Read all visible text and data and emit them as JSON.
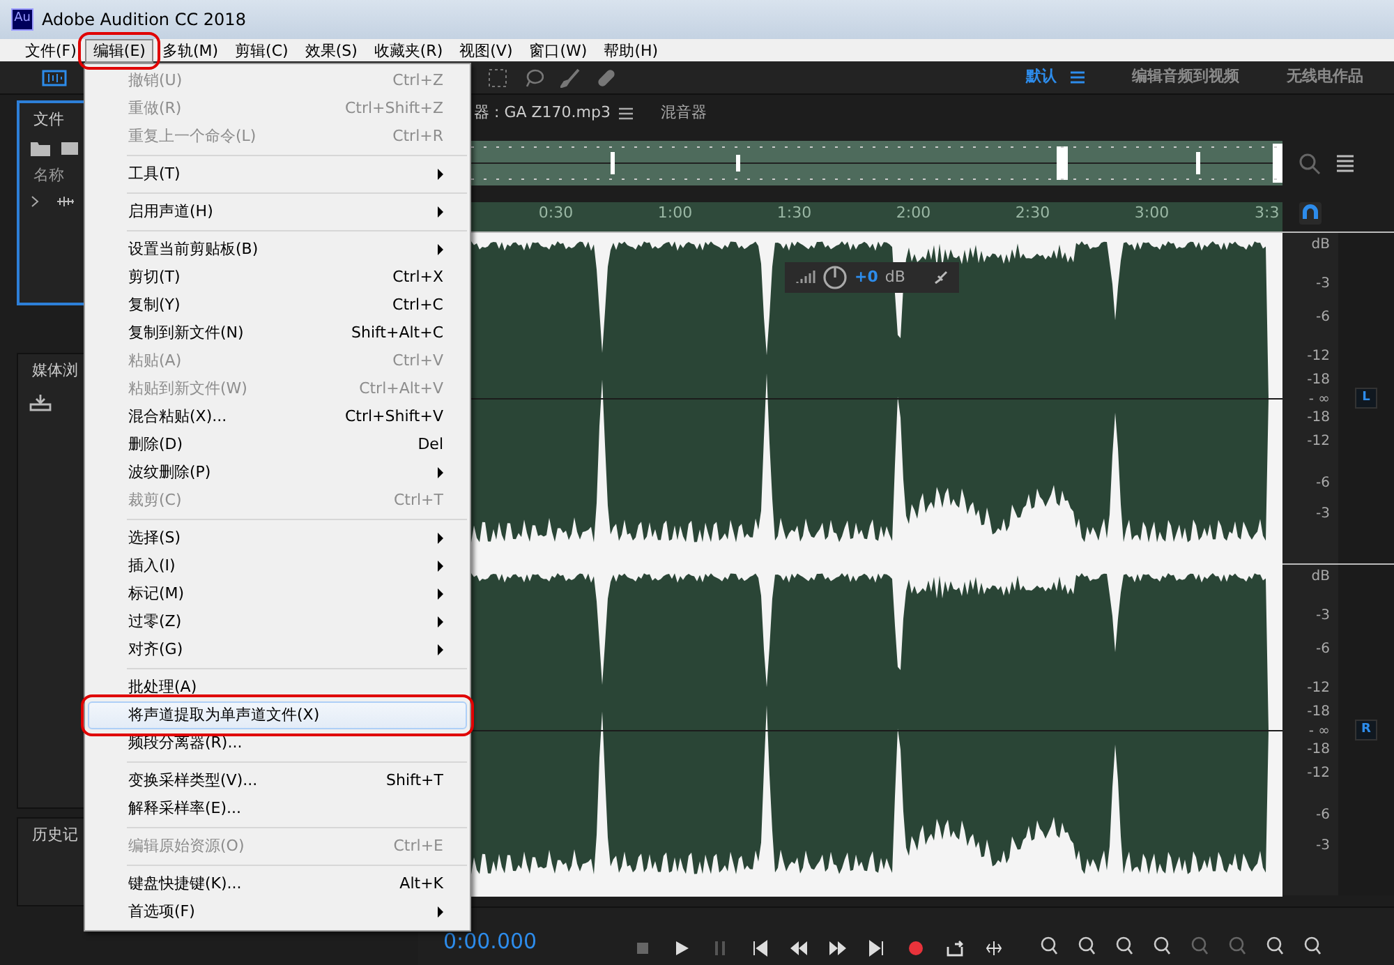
{
  "window": {
    "logo": "Au",
    "title": "Adobe Audition CC 2018"
  },
  "menubar": [
    {
      "label": "文件(F)",
      "selected": false,
      "circled": false
    },
    {
      "label": "编辑(E)",
      "selected": true,
      "circled": true
    },
    {
      "label": "多轨(M)",
      "selected": false,
      "circled": false
    },
    {
      "label": "剪辑(C)",
      "selected": false,
      "circled": false
    },
    {
      "label": "效果(S)",
      "selected": false,
      "circled": false
    },
    {
      "label": "收藏夹(R)",
      "selected": false,
      "circled": false
    },
    {
      "label": "视图(V)",
      "selected": false,
      "circled": false
    },
    {
      "label": "窗口(W)",
      "selected": false,
      "circled": false
    },
    {
      "label": "帮助(H)",
      "selected": false,
      "circled": false
    }
  ],
  "workspaces": [
    {
      "label": "默认",
      "selected": true
    },
    {
      "label": "编辑音频到视频",
      "selected": false
    },
    {
      "label": "无线电作品",
      "selected": false
    }
  ],
  "files_panel": {
    "tab": "文件",
    "column": "名称"
  },
  "media_panel": {
    "tab": "媒体浏"
  },
  "history_panel": {
    "tab": "历史记"
  },
  "editor": {
    "tabs": [
      {
        "label": "器 : GA  Z170.mp3",
        "selected": true
      },
      {
        "label": "混音器",
        "selected": false
      }
    ],
    "ruler": [
      "0:30",
      "1:00",
      "1:30",
      "2:00",
      "2:30",
      "3:00",
      "3:3"
    ],
    "hud": {
      "gain": "+0",
      "unit": "dB"
    },
    "channels": [
      {
        "label": "L",
        "scale": [
          "dB",
          "-3",
          "-6",
          "-12",
          "-18",
          "- ∞",
          "-18",
          "-12",
          "-6",
          "-3"
        ]
      },
      {
        "label": "R",
        "scale": [
          "dB",
          "-3",
          "-6",
          "-12",
          "-18",
          "- ∞",
          "-18",
          "-12",
          "-6",
          "-3"
        ]
      }
    ]
  },
  "transport": {
    "time": "0:00.000"
  },
  "edit_menu": [
    {
      "kind": "item",
      "label": "撤销(U)",
      "shortcut": "Ctrl+Z",
      "disabled": true,
      "submenu": false,
      "selected": false,
      "circled": false
    },
    {
      "kind": "item",
      "label": "重做(R)",
      "shortcut": "Ctrl+Shift+Z",
      "disabled": true,
      "submenu": false,
      "selected": false,
      "circled": false
    },
    {
      "kind": "item",
      "label": "重复上一个命令(L)",
      "shortcut": "Ctrl+R",
      "disabled": true,
      "submenu": false,
      "selected": false,
      "circled": false
    },
    {
      "kind": "separator"
    },
    {
      "kind": "item",
      "label": "工具(T)",
      "disabled": false,
      "submenu": true,
      "selected": false,
      "circled": false
    },
    {
      "kind": "separator"
    },
    {
      "kind": "item",
      "label": "启用声道(H)",
      "disabled": false,
      "submenu": true,
      "selected": false,
      "circled": false
    },
    {
      "kind": "separator"
    },
    {
      "kind": "item",
      "label": "设置当前剪贴板(B)",
      "disabled": false,
      "submenu": true,
      "selected": false,
      "circled": false
    },
    {
      "kind": "item",
      "label": "剪切(T)",
      "shortcut": "Ctrl+X",
      "disabled": false,
      "submenu": false,
      "selected": false,
      "circled": false
    },
    {
      "kind": "item",
      "label": "复制(Y)",
      "shortcut": "Ctrl+C",
      "disabled": false,
      "submenu": false,
      "selected": false,
      "circled": false
    },
    {
      "kind": "item",
      "label": "复制到新文件(N)",
      "shortcut": "Shift+Alt+C",
      "disabled": false,
      "submenu": false,
      "selected": false,
      "circled": false
    },
    {
      "kind": "item",
      "label": "粘贴(A)",
      "shortcut": "Ctrl+V",
      "disabled": true,
      "submenu": false,
      "selected": false,
      "circled": false
    },
    {
      "kind": "item",
      "label": "粘贴到新文件(W)",
      "shortcut": "Ctrl+Alt+V",
      "disabled": true,
      "submenu": false,
      "selected": false,
      "circled": false
    },
    {
      "kind": "item",
      "label": "混合粘贴(X)...",
      "shortcut": "Ctrl+Shift+V",
      "disabled": false,
      "submenu": false,
      "selected": false,
      "circled": false
    },
    {
      "kind": "item",
      "label": "删除(D)",
      "shortcut": "Del",
      "disabled": false,
      "submenu": false,
      "selected": false,
      "circled": false
    },
    {
      "kind": "item",
      "label": "波纹删除(P)",
      "disabled": false,
      "submenu": true,
      "selected": false,
      "circled": false
    },
    {
      "kind": "item",
      "label": "裁剪(C)",
      "shortcut": "Ctrl+T",
      "disabled": true,
      "submenu": false,
      "selected": false,
      "circled": false
    },
    {
      "kind": "separator"
    },
    {
      "kind": "item",
      "label": "选择(S)",
      "disabled": false,
      "submenu": true,
      "selected": false,
      "circled": false
    },
    {
      "kind": "item",
      "label": "插入(I)",
      "disabled": false,
      "submenu": true,
      "selected": false,
      "circled": false
    },
    {
      "kind": "item",
      "label": "标记(M)",
      "disabled": false,
      "submenu": true,
      "selected": false,
      "circled": false
    },
    {
      "kind": "item",
      "label": "过零(Z)",
      "disabled": false,
      "submenu": true,
      "selected": false,
      "circled": false
    },
    {
      "kind": "item",
      "label": "对齐(G)",
      "disabled": false,
      "submenu": true,
      "selected": false,
      "circled": false
    },
    {
      "kind": "separator"
    },
    {
      "kind": "item",
      "label": "批处理(A)",
      "disabled": false,
      "submenu": false,
      "selected": false,
      "circled": false
    },
    {
      "kind": "item",
      "label": "将声道提取为单声道文件(X)",
      "disabled": false,
      "submenu": false,
      "selected": true,
      "circled": true
    },
    {
      "kind": "item",
      "label": "频段分离器(R)...",
      "disabled": false,
      "submenu": false,
      "selected": false,
      "circled": false
    },
    {
      "kind": "separator"
    },
    {
      "kind": "item",
      "label": "变换采样类型(V)...",
      "shortcut": "Shift+T",
      "disabled": false,
      "submenu": false,
      "selected": false,
      "circled": false
    },
    {
      "kind": "item",
      "label": "解释采样率(E)...",
      "disabled": false,
      "submenu": false,
      "selected": false,
      "circled": false
    },
    {
      "kind": "separator"
    },
    {
      "kind": "item",
      "label": "编辑原始资源(O)",
      "shortcut": "Ctrl+E",
      "disabled": true,
      "submenu": false,
      "selected": false,
      "circled": false
    },
    {
      "kind": "separator"
    },
    {
      "kind": "item",
      "label": "键盘快捷键(K)...",
      "shortcut": "Alt+K",
      "disabled": false,
      "submenu": false,
      "selected": false,
      "circled": false
    },
    {
      "kind": "item",
      "label": "首选项(F)",
      "disabled": false,
      "submenu": true,
      "selected": false,
      "circled": false
    }
  ]
}
